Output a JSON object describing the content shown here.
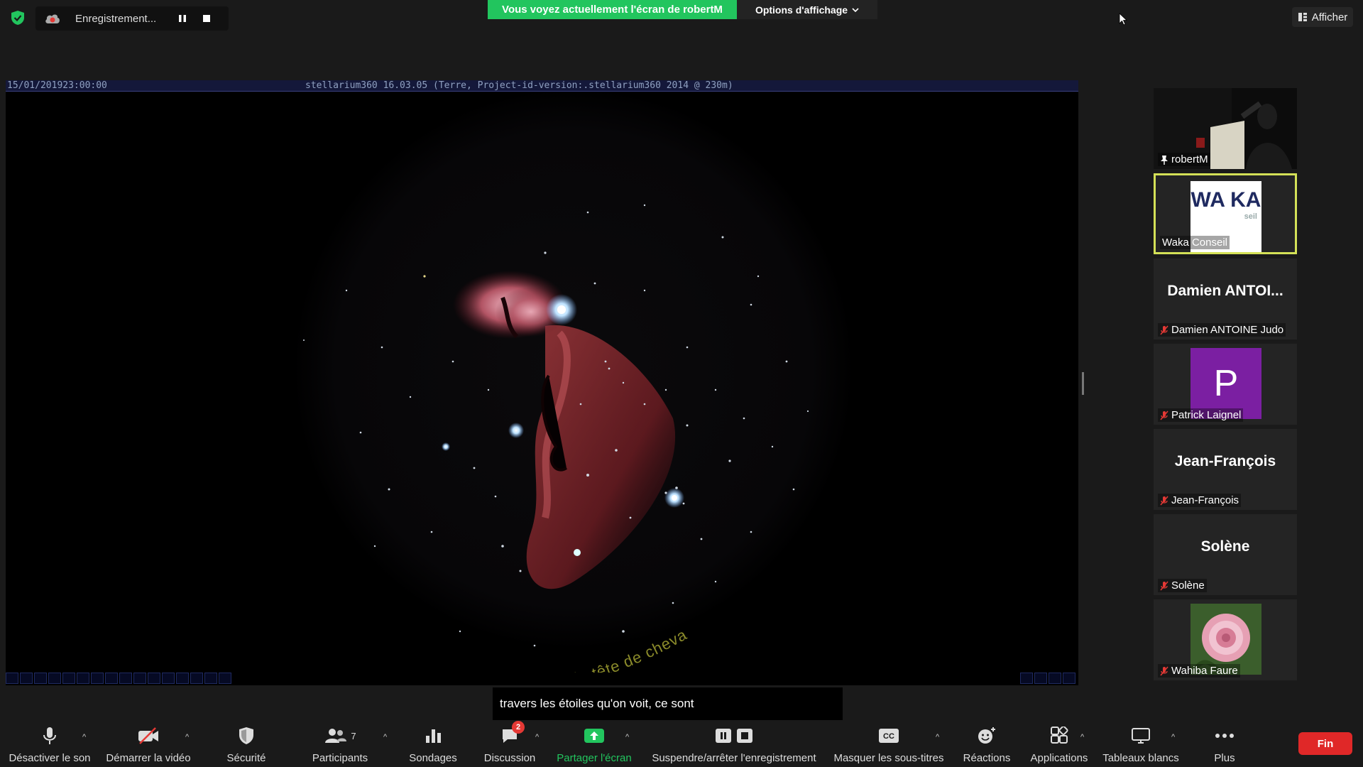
{
  "top": {
    "recording_label": "Enregistrement...",
    "banner": "Vous voyez actuellement l'écran de robertM",
    "view_options": "Options d'affichage",
    "show_button": "Afficher"
  },
  "shared_screen": {
    "datetime": "15/01/201923:00:00",
    "version": "stellarium360 16.03.05 (Terre, Project-id-version:.stellarium360 2014 @ 230m)",
    "object_label": "Nébuleuse de la tête de cheval"
  },
  "gallery": [
    {
      "name": "robertM",
      "type": "video",
      "muted": false,
      "pinned": true
    },
    {
      "name": "Waka Conseil",
      "type": "logo",
      "muted": false,
      "active": true,
      "logo_text": "WA KA",
      "logo_sub": "seil"
    },
    {
      "name": "Damien ANTOINE Judo",
      "display": "Damien  ANTOI...",
      "type": "name",
      "muted": true
    },
    {
      "name": "Patrick Laignel",
      "type": "avatar",
      "avatar_letter": "P",
      "avatar_color": "#7b1fa2",
      "muted": true
    },
    {
      "name": "Jean-François",
      "display": "Jean-François",
      "type": "name",
      "muted": true
    },
    {
      "name": "Solène",
      "display": "Solène",
      "type": "name",
      "muted": true
    },
    {
      "name": "Wahiba Faure",
      "type": "photo",
      "muted": true
    }
  ],
  "caption": "travers les étoiles qu'on voit, ce sont",
  "toolbar": {
    "mute": "Désactiver le son",
    "video": "Démarrer la vidéo",
    "security": "Sécurité",
    "participants": "Participants",
    "participants_count": "7",
    "polls": "Sondages",
    "chat": "Discussion",
    "chat_badge": "2",
    "share": "Partager l'écran",
    "record": "Suspendre/arrêter l'enregistrement",
    "captions": "Masquer les sous-titres",
    "reactions": "Réactions",
    "apps": "Applications",
    "whiteboards": "Tableaux blancs",
    "more": "Plus",
    "end": "Fin"
  },
  "colors": {
    "share_green": "#22c55e",
    "end_red": "#e02828",
    "active_speaker": "#d4e157"
  }
}
